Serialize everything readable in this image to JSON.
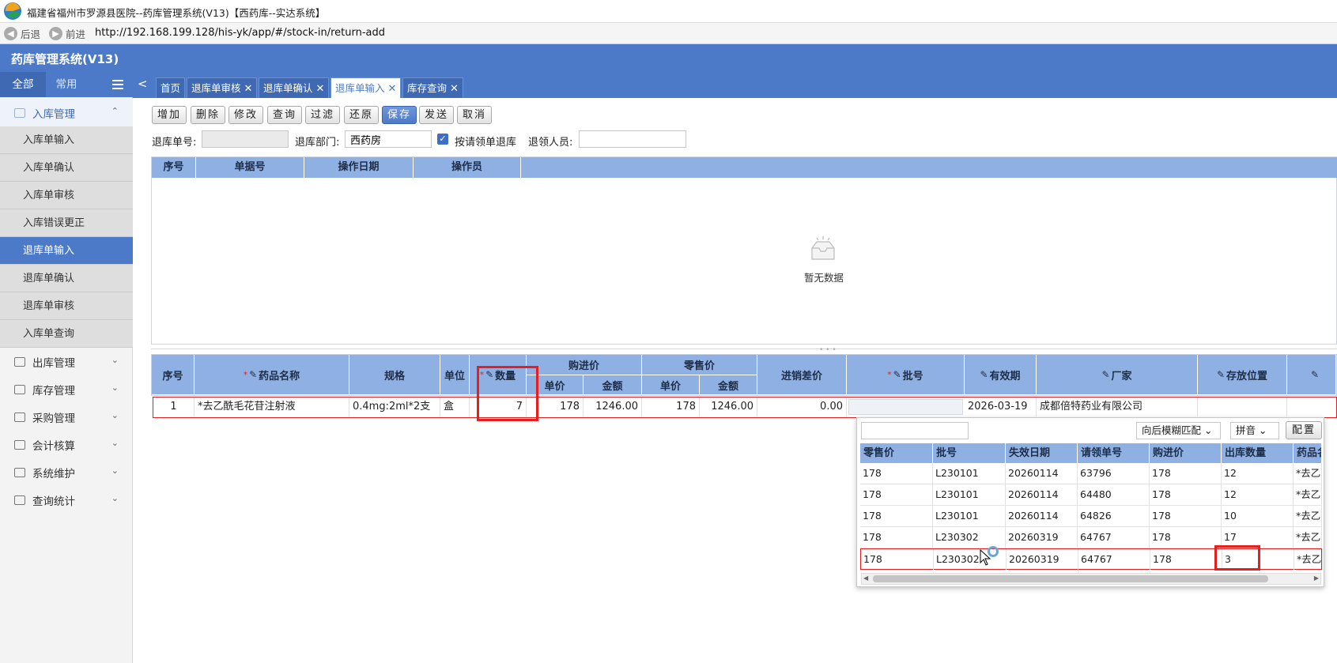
{
  "window": {
    "title": "福建省福州市罗源县医院--药库管理系统(V13)【西药库--实达系统】"
  },
  "browser": {
    "back_label": "后退",
    "forward_label": "前进",
    "url": "http://192.168.199.128/his-yk/app/#/stock-in/return-add"
  },
  "app": {
    "title": "药库管理系统(V13)"
  },
  "sidebar": {
    "tabs": [
      "全部",
      "常用"
    ],
    "active_group": "入库管理",
    "groups": [
      "入库管理",
      "出库管理",
      "库存管理",
      "采购管理",
      "会计核算",
      "系统维护",
      "查询统计"
    ],
    "items": [
      "入库单输入",
      "入库单确认",
      "入库单审核",
      "入库错误更正",
      "退库单输入",
      "退库单确认",
      "退库单审核",
      "入库单查询"
    ],
    "active_item": "退库单输入"
  },
  "tabs": [
    "首页",
    "退库单审核",
    "退库单确认",
    "退库单输入",
    "库存查询"
  ],
  "active_tab": "退库单输入",
  "toolbar": [
    "增加",
    "删除",
    "修改",
    "查询",
    "过滤",
    "还原",
    "保存",
    "发送",
    "取消"
  ],
  "filters": {
    "doc_no_label": "退库单号:",
    "doc_no_value": "",
    "dept_label": "退库部门:",
    "dept_value": "西药房",
    "by_request_label": "按请领单退库",
    "by_request_checked": true,
    "person_label": "退领人员:",
    "person_value": ""
  },
  "upper_grid": {
    "columns": [
      "序号",
      "单据号",
      "操作日期",
      "操作员"
    ],
    "empty_text": "暂无数据"
  },
  "lower_grid": {
    "columns": {
      "seq": "序号",
      "name": "药品名称",
      "spec": "规格",
      "unit": "单位",
      "qty": "数量",
      "purchase": "购进价",
      "retail": "零售价",
      "unit_price": "单价",
      "amount": "金额",
      "diff": "进销差价",
      "batch": "批号",
      "expiry": "有效期",
      "maker": "厂家",
      "location": "存放位置"
    },
    "rows": [
      {
        "seq": "1",
        "name": "*去乙酰毛花苷注射液",
        "spec": "0.4mg:2ml*2支",
        "unit": "盒",
        "qty": "7",
        "buy_price": "178",
        "buy_amount": "1246.00",
        "sell_price": "178",
        "sell_amount": "1246.00",
        "diff": "0.00",
        "batch": "",
        "expiry": "2026-03-19",
        "maker": "成都倍特药业有限公司",
        "location": ""
      }
    ]
  },
  "popup": {
    "search_value": "",
    "match_mode": "向后模糊匹配",
    "input_mode": "拼音",
    "config_label": "配置",
    "columns": [
      "零售价",
      "批号",
      "失效日期",
      "请领单号",
      "购进价",
      "出库数量",
      "药品名"
    ],
    "rows": [
      [
        "178",
        "L230101",
        "20260114",
        "63796",
        "178",
        "12",
        "*去乙酰"
      ],
      [
        "178",
        "L230101",
        "20260114",
        "64480",
        "178",
        "12",
        "*去乙酰"
      ],
      [
        "178",
        "L230101",
        "20260114",
        "64826",
        "178",
        "10",
        "*去乙酰"
      ],
      [
        "178",
        "L230302",
        "20260319",
        "64767",
        "178",
        "17",
        "*去乙酰"
      ],
      [
        "178",
        "L230302",
        "20260319",
        "64767",
        "178",
        "3",
        "*去乙酰"
      ]
    ]
  }
}
